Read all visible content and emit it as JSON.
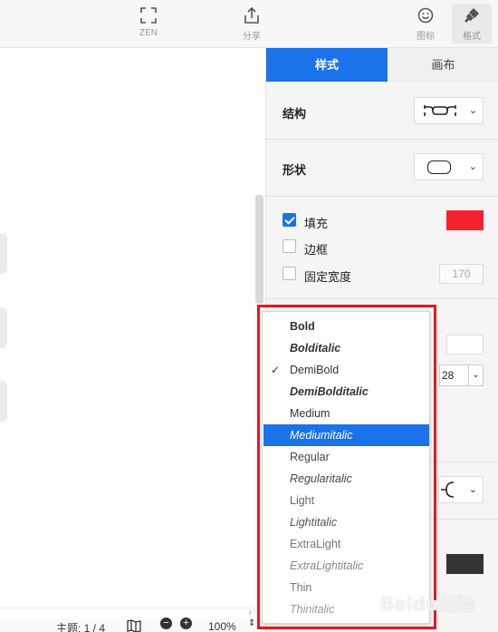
{
  "toolbar": {
    "zen_label": "ZEN",
    "share_label": "分享",
    "icon_label": "图标",
    "format_label": "格式"
  },
  "status": {
    "theme": "主题: 1 / 4",
    "zoom": "100%",
    "zoom_out": "−",
    "zoom_in": "+"
  },
  "panel": {
    "tabs": [
      {
        "label": "样式",
        "active": true
      },
      {
        "label": "画布",
        "active": false
      }
    ],
    "structure_label": "结构",
    "shape_label": "形状",
    "fill_label": "填充",
    "fill_checked": true,
    "fill_color": "#f5222d",
    "border_label": "边框",
    "border_checked": false,
    "fixed_width_label": "固定宽度",
    "fixed_width_checked": false,
    "fixed_width_value": "170",
    "font_size_value": "28"
  },
  "font_weight_menu": {
    "items": [
      {
        "label": "Bold",
        "weight": "bold",
        "italic": false
      },
      {
        "label": "Bolditalic",
        "weight": "bold",
        "italic": true
      },
      {
        "label": "DemiBold",
        "weight": "normal",
        "italic": false,
        "checked": true
      },
      {
        "label": "DemiBolditalic",
        "weight": "bold",
        "italic": true
      },
      {
        "label": "Medium",
        "weight": "normal",
        "italic": false
      },
      {
        "label": "Mediumitalic",
        "weight": "normal",
        "italic": true,
        "selected": true
      },
      {
        "label": "Regular",
        "weight": "normal",
        "italic": false
      },
      {
        "label": "Regularitalic",
        "weight": "normal",
        "italic": true
      },
      {
        "label": "Light",
        "weight": "light",
        "italic": false
      },
      {
        "label": "Lightitalic",
        "weight": "light",
        "italic": true
      },
      {
        "label": "ExtraLight",
        "weight": "light",
        "italic": false
      },
      {
        "label": "ExtraLightitalic",
        "weight": "light",
        "italic": true
      },
      {
        "label": "Thin",
        "weight": "light",
        "italic": false
      },
      {
        "label": "Thinitalic",
        "weight": "light",
        "italic": true
      }
    ],
    "check_glyph": "✓"
  },
  "watermark": "Baidu经验"
}
